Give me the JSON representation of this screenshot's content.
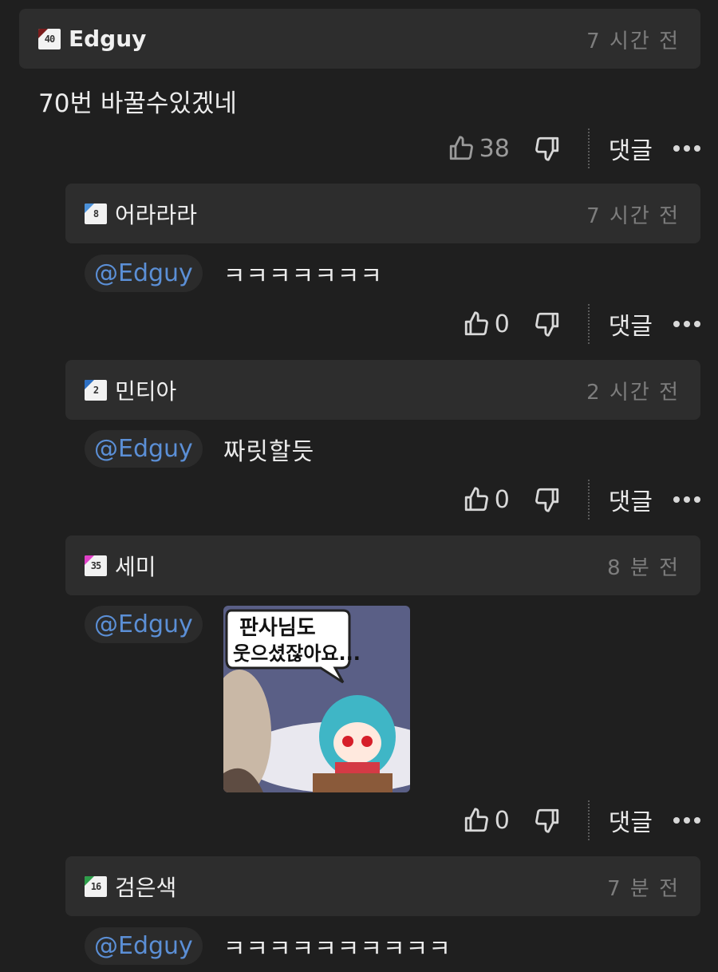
{
  "comments": [
    {
      "author": "Edguy",
      "level": "40",
      "level_color": "#7a1c1c",
      "time": "7 시간 전",
      "text": "70번 바꿀수있겠네",
      "likes": "38",
      "reply_label": "댓글"
    },
    {
      "author": "어라라라",
      "level": "8",
      "level_color": "#4a90d9",
      "time": "7 시간 전",
      "mention": "@Edguy",
      "text": "ㅋㅋㅋㅋㅋㅋㅋ",
      "likes": "0",
      "reply_label": "댓글"
    },
    {
      "author": "민티아",
      "level": "2",
      "level_color": "#2d6fc2",
      "time": "2 시간 전",
      "mention": "@Edguy",
      "text": "짜릿할듯",
      "likes": "0",
      "reply_label": "댓글"
    },
    {
      "author": "세미",
      "level": "35",
      "level_color": "#e040c8",
      "time": "8 분 전",
      "mention": "@Edguy",
      "sticker_text": [
        "판사님도",
        "웃으셨잖아요..."
      ],
      "likes": "0",
      "reply_label": "댓글"
    },
    {
      "author": "검은색",
      "level": "16",
      "level_color": "#2e9e4a",
      "time": "7 분 전",
      "mention": "@Edguy",
      "text": "ㅋㅋㅋㅋㅋㅋㅋㅋㅋㅋ"
    }
  ],
  "icons": {
    "like": "thumbs-up-icon",
    "dislike": "thumbs-down-icon",
    "more": "more-dots-icon"
  }
}
